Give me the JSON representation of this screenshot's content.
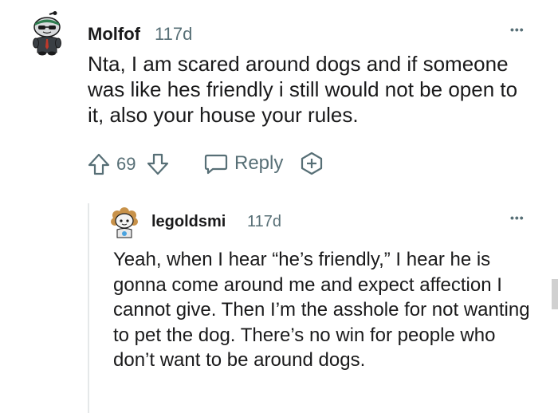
{
  "comments": [
    {
      "username": "Molfof",
      "timestamp": "117d",
      "text": "Nta, I am scared around dogs and if someone was like hes friendly i still would not be open to it, also your house your rules.",
      "votes": "69",
      "reply_label": "Reply",
      "more_label": "•••",
      "avatar_icon": "snoo-avatar-icon"
    },
    {
      "username": "legoldsmi",
      "timestamp": "117d",
      "text": "Yeah, when I hear “he’s friendly,” I hear he is gonna come around me and expect affection I cannot give. Then I’m the asshole for not wanting to pet the dog. There’s no win for people who don’t want to be around dogs.",
      "more_label": "•••",
      "avatar_icon": "snoo-avatar-icon"
    }
  ],
  "icons": {
    "upvote": "upvote-arrow-icon",
    "downvote": "downvote-arrow-icon",
    "reply": "speech-bubble-icon",
    "award": "award-plus-icon"
  },
  "colors": {
    "text": "#1a1a1b",
    "meta": "#576f76",
    "icon": "#576f76"
  }
}
